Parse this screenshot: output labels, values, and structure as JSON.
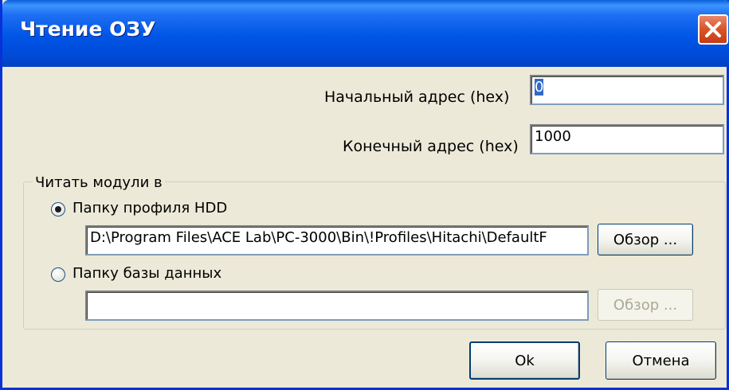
{
  "window": {
    "title": "Чтение ОЗУ",
    "title_bar_color": "#0055e5",
    "close_button_color": "#d9582c"
  },
  "fields": {
    "start_address_label": "Начальный адрес (hex)",
    "start_address_value": "0",
    "end_address_label": "Конечный адрес (hex)",
    "end_address_value": "1000"
  },
  "group": {
    "legend": "Читать модули в",
    "options": [
      {
        "label": "Папку профиля HDD",
        "checked": true,
        "path": "D:\\Program Files\\ACE Lab\\PC-3000\\Bin\\!Profiles\\Hitachi\\DefaultF",
        "browse_label": "Обзор ...",
        "browse_enabled": true
      },
      {
        "label": "Папку базы данных",
        "checked": false,
        "path": "",
        "browse_label": "Обзор ...",
        "browse_enabled": false
      }
    ]
  },
  "buttons": {
    "ok_label": "Ok",
    "cancel_label": "Отмена"
  }
}
